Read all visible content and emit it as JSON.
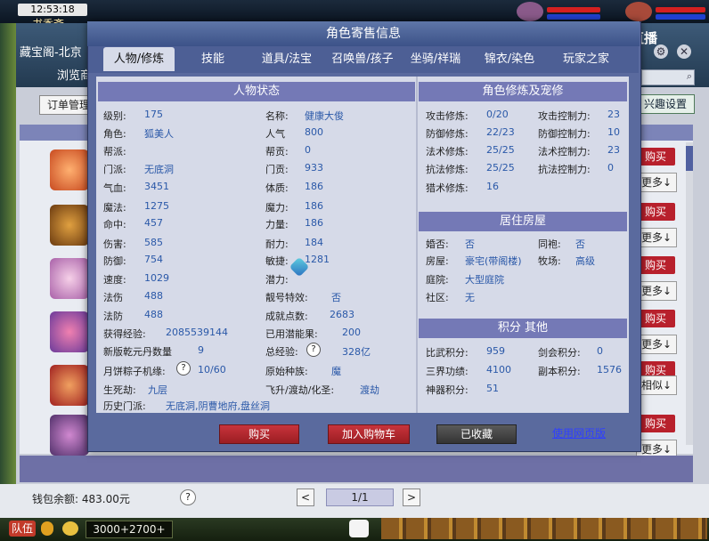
{
  "hud": {
    "clock": "12:53:18",
    "location": "书香斋",
    "coords": "3000+2700+",
    "team_label": "队伍"
  },
  "stream": {
    "logo": "CC直播"
  },
  "market": {
    "header_tabs": [
      "藏宝阁-北京",
      "浏览商"
    ],
    "order_button": "订单管理",
    "fav_button": "兴趣设置",
    "buy_label": "购买",
    "more_label": "更多",
    "similar_label": "相似",
    "wallet": "钱包余额: 483.00元",
    "help": "?",
    "prev": "<",
    "next": ">",
    "page": "1/1"
  },
  "dialog": {
    "title": "角色寄售信息",
    "tabs": [
      "人物/修炼",
      "技能",
      "道具/法宝",
      "召唤兽/孩子",
      "坐骑/祥瑞",
      "锦衣/染色",
      "玩家之家"
    ],
    "active_tab": 0,
    "sections": {
      "status": "人物状态",
      "cultivation": "角色修炼及宠修",
      "house": "居住房屋",
      "points": "积分 其他"
    },
    "status_left": [
      {
        "label": "级别:",
        "value": "175"
      },
      {
        "label": "角色:",
        "value": "狐美人"
      },
      {
        "label": "帮派:",
        "value": ""
      },
      {
        "label": "门派:",
        "value": "无底洞"
      },
      {
        "label": "气血:",
        "value": "3451"
      },
      {
        "label": "魔法:",
        "value": "1275"
      },
      {
        "label": "命中:",
        "value": "457"
      },
      {
        "label": "伤害:",
        "value": "585"
      },
      {
        "label": "防御:",
        "value": "754"
      },
      {
        "label": "速度:",
        "value": "1029"
      },
      {
        "label": "法伤",
        "value": "488"
      },
      {
        "label": "法防",
        "value": "488"
      }
    ],
    "status_right": [
      {
        "label": "名称:",
        "value": "健康大俊"
      },
      {
        "label": "人气",
        "value": "800"
      },
      {
        "label": "帮贡:",
        "value": "0"
      },
      {
        "label": "门贡:",
        "value": "933"
      },
      {
        "label": "体质:",
        "value": "186"
      },
      {
        "label": "魔力:",
        "value": "186"
      },
      {
        "label": "力量:",
        "value": "186"
      },
      {
        "label": "耐力:",
        "value": "184"
      },
      {
        "label": "敏捷:",
        "value": "1281"
      },
      {
        "label": "潜力:",
        "value": ""
      },
      {
        "label": "靓号特效:",
        "value": "否"
      },
      {
        "label": "成就点数:",
        "value": "2683"
      }
    ],
    "extra": {
      "exp_label": "获得经验:",
      "exp_value": "2085539144",
      "used_pot_label": "已用潜能果:",
      "used_pot_value": "200",
      "qianyuan_label": "新版乾元丹数量",
      "qianyuan_value": "9",
      "total_exp_label": "总经验:",
      "total_exp_value": "328亿",
      "zongzi_label": "月饼粽子机缘:",
      "zongzi_value": "10/60",
      "race_label": "原始种族:",
      "race_value": "魔",
      "shengsi_label": "生死劫:",
      "shengsi_value": "九层",
      "feisheng_label": "飞升/渡劫/化圣:",
      "feisheng_value": "渡劫",
      "history_label": "历史门派:",
      "history_value": "无底洞,阴曹地府,盘丝洞"
    },
    "cultivation_rows": [
      {
        "a_label": "攻击修炼:",
        "a_value": "0/20",
        "b_label": "攻击控制力:",
        "b_value": "23"
      },
      {
        "a_label": "防御修炼:",
        "a_value": "22/23",
        "b_label": "防御控制力:",
        "b_value": "10"
      },
      {
        "a_label": "法术修炼:",
        "a_value": "25/25",
        "b_label": "法术控制力:",
        "b_value": "23"
      },
      {
        "a_label": "抗法修炼:",
        "a_value": "25/25",
        "b_label": "抗法控制力:",
        "b_value": "0"
      },
      {
        "a_label": "猎术修炼:",
        "a_value": "16",
        "b_label": "",
        "b_value": ""
      }
    ],
    "house_rows": [
      {
        "a_label": "婚否:",
        "a_value": "否",
        "b_label": "同袍:",
        "b_value": "否"
      },
      {
        "a_label": "房屋:",
        "a_value": "豪宅(带阁楼)",
        "b_label": "牧场:",
        "b_value": "高级"
      },
      {
        "a_label": "庭院:",
        "a_value": "大型庭院",
        "b_label": "",
        "b_value": ""
      },
      {
        "a_label": "社区:",
        "a_value": "无",
        "b_label": "",
        "b_value": ""
      }
    ],
    "points_rows": [
      {
        "a_label": "比武积分:",
        "a_value": "959",
        "b_label": "剑会积分:",
        "b_value": "0"
      },
      {
        "a_label": "三界功绩:",
        "a_value": "4100",
        "b_label": "副本积分:",
        "b_value": "1576"
      },
      {
        "a_label": "神器积分:",
        "a_value": "51",
        "b_label": "",
        "b_value": ""
      }
    ],
    "buttons": {
      "buy": "购买",
      "cart": "加入购物车",
      "collected": "已收藏",
      "web": "使用网页版"
    },
    "help": "?"
  },
  "colors": {
    "accent": "#7479b6",
    "buy": "#b8202c",
    "value": "#2a58a8"
  }
}
